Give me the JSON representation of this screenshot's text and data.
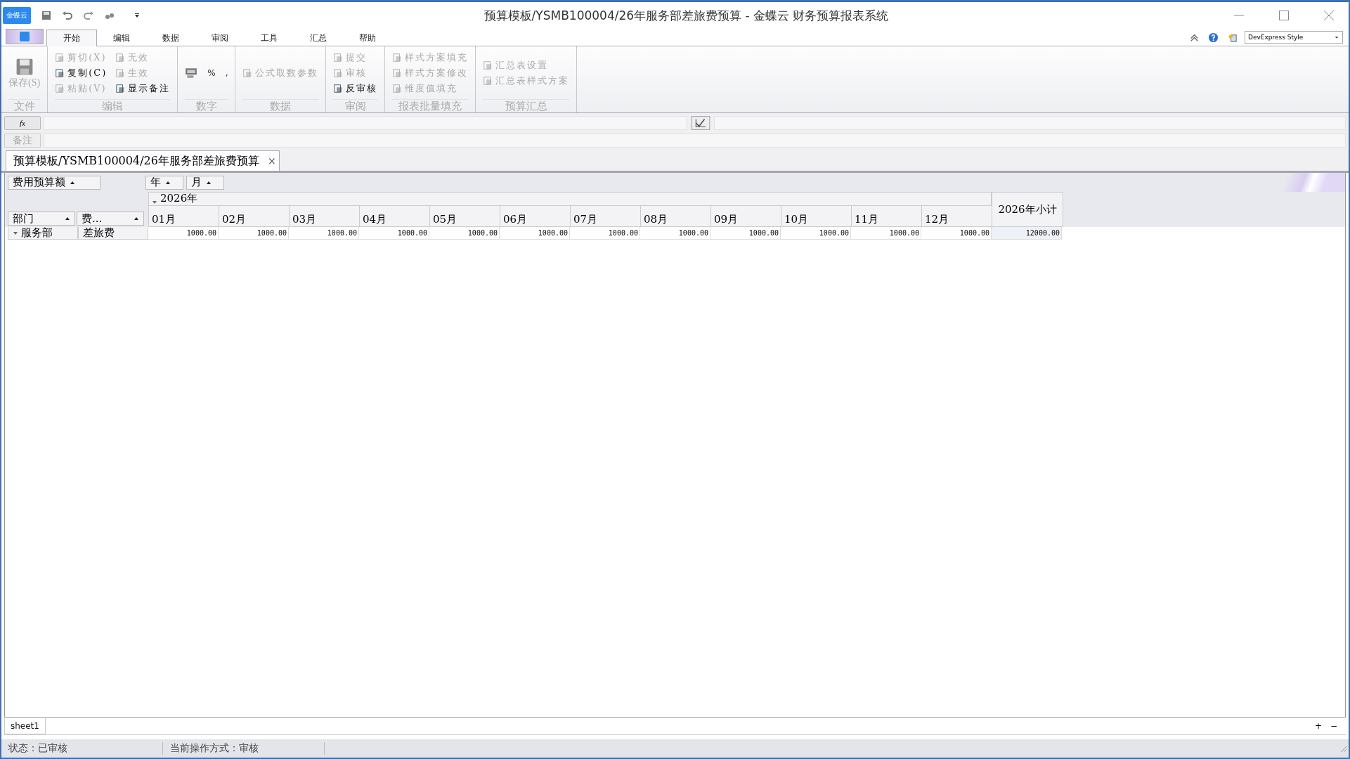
{
  "window": {
    "title": "预算模板/YSMB100004/26年服务部差旅费预算 - 金蝶云 财务预算报表系统",
    "logo": "金蝶云"
  },
  "tabs": [
    {
      "label": "开始",
      "selected": true
    },
    {
      "label": "编辑",
      "selected": false
    },
    {
      "label": "数据",
      "selected": false
    },
    {
      "label": "审阅",
      "selected": false
    },
    {
      "label": "工具",
      "selected": false
    },
    {
      "label": "汇总",
      "selected": false
    },
    {
      "label": "帮助",
      "selected": false
    }
  ],
  "style_selector": {
    "value": "DevExpress Style"
  },
  "ribbon_groups": [
    {
      "label": "文件",
      "columns": [
        [
          {
            "kind": "large",
            "label": "保存(S)",
            "disabled": true
          }
        ]
      ]
    },
    {
      "label": "编辑",
      "columns": [
        [
          {
            "kind": "small",
            "label": "剪切(X)",
            "disabled": true
          },
          {
            "kind": "small",
            "label": "复制(C)",
            "disabled": false
          },
          {
            "kind": "small",
            "label": "粘贴(V)",
            "disabled": true
          }
        ],
        [
          {
            "kind": "small",
            "label": "无效",
            "disabled": true
          },
          {
            "kind": "small",
            "label": "生效",
            "disabled": true
          },
          {
            "kind": "small",
            "label": "显示备注",
            "disabled": false
          }
        ]
      ]
    },
    {
      "label": "数字",
      "columns": [
        [
          {
            "kind": "row",
            "items": [
              {
                "kind": "icon"
              },
              {
                "kind": "glyph",
                "label": "%",
                "disabled": false
              },
              {
                "kind": "glyph",
                "label": ",",
                "disabled": false
              }
            ]
          }
        ]
      ]
    },
    {
      "label": "数据",
      "columns": [
        [
          {
            "kind": "small",
            "label": "公式取数参数",
            "disabled": true
          }
        ]
      ]
    },
    {
      "label": "审阅",
      "columns": [
        [
          {
            "kind": "small",
            "label": "提交",
            "disabled": true
          },
          {
            "kind": "small",
            "label": "审核",
            "disabled": true
          },
          {
            "kind": "small",
            "label": "反审核",
            "disabled": false
          }
        ]
      ]
    },
    {
      "label": "报表批量填充",
      "columns": [
        [
          {
            "kind": "small",
            "label": "样式方案填充",
            "disabled": true
          },
          {
            "kind": "small",
            "label": "样式方案修改",
            "disabled": true
          },
          {
            "kind": "small",
            "label": "维度值填充",
            "disabled": true
          }
        ]
      ]
    },
    {
      "label": "预算汇总",
      "columns": [
        [
          {
            "kind": "small",
            "label": "汇总表设置",
            "disabled": true
          },
          {
            "kind": "small",
            "label": "汇总表样式方案",
            "disabled": true
          }
        ]
      ]
    }
  ],
  "formula_bar": {
    "button": "fx"
  },
  "note_bar": {
    "button": "备注",
    "disabled": true
  },
  "document_tab": {
    "label": "预算模板/YSMB100004/26年服务部差旅费预算",
    "close": "×"
  },
  "pivot": {
    "data_field": "费用预算额",
    "column_fields": [
      "年",
      "月"
    ],
    "row_fields": [
      "部门",
      "费..."
    ],
    "year": "2026年",
    "months": [
      "01月",
      "02月",
      "03月",
      "04月",
      "05月",
      "06月",
      "07月",
      "08月",
      "09月",
      "10月",
      "11月",
      "12月"
    ],
    "total_header": "2026年小计",
    "rows": [
      {
        "department": "服务部",
        "expense": "差旅费",
        "values": [
          "1000.00",
          "1000.00",
          "1000.00",
          "1000.00",
          "1000.00",
          "1000.00",
          "1000.00",
          "1000.00",
          "1000.00",
          "1000.00",
          "1000.00",
          "1000.00"
        ],
        "total": "12000.00"
      }
    ]
  },
  "sheet_tabs": [
    {
      "label": "sheet1",
      "selected": true
    }
  ],
  "sheet_controls": [
    "+",
    "−"
  ],
  "status_bar": [
    "状态：已审核",
    "当前操作方式：审核"
  ]
}
